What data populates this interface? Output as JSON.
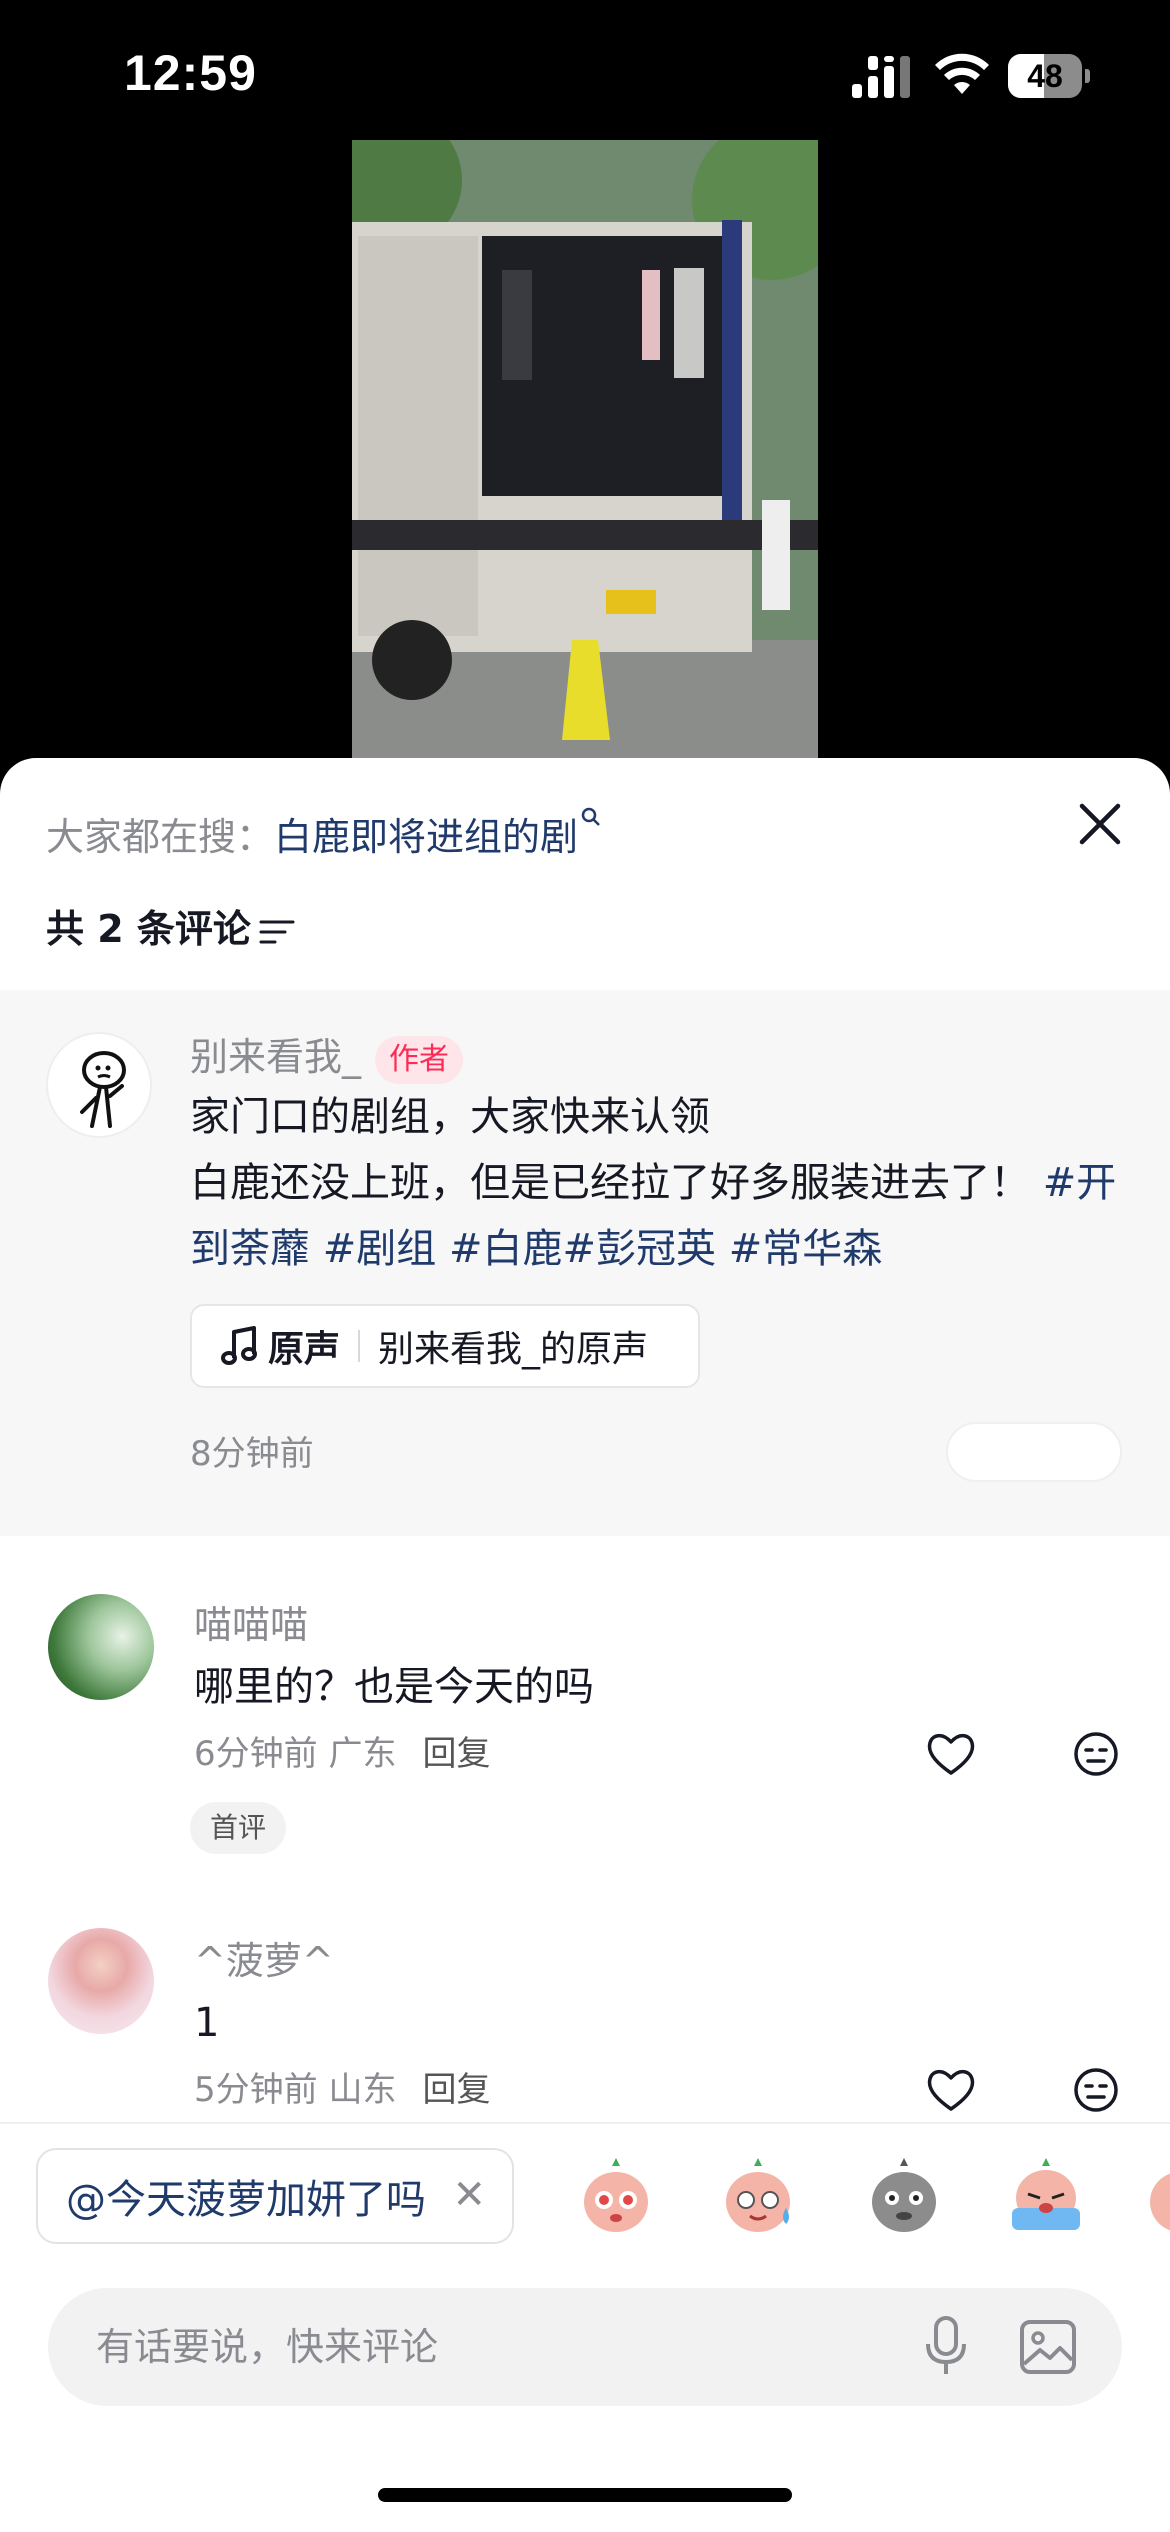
{
  "status_bar": {
    "time": "12:59",
    "battery": "48",
    "battery_level": 0.48
  },
  "sheet": {
    "search_prefix": "大家都在搜：",
    "search_keyword": "白鹿即将进组的剧",
    "comment_count_label": "共 2 条评论"
  },
  "author_comment": {
    "username": "别来看我_",
    "author_tag": "作者",
    "line1": "家门口的剧组，大家快来认领",
    "line2_text": "白鹿还没上班，但是已经拉了好多服装进去了！",
    "hashtag_1": "#开到荼蘼",
    "hashtag_2": "#剧组",
    "hashtag_3": "#白鹿",
    "hashtag_4": "#彭冠英",
    "hashtag_5": "#常华森",
    "sound_label": "原声",
    "sound_title": "别来看我_的原声",
    "time": "8分钟前"
  },
  "comments": [
    {
      "username": "喵喵喵",
      "text": "哪里的？也是今天的吗",
      "time": "6分钟前",
      "location": "广东",
      "reply": "回复",
      "badge": "首评"
    },
    {
      "username": "^菠萝^",
      "text": "1",
      "time": "5分钟前",
      "location": "山东",
      "reply": "回复"
    }
  ],
  "composer": {
    "mention": "@今天菠萝加妍了吗",
    "placeholder": "有话要说，快来评论"
  },
  "icons": [
    "signal-icon",
    "wifi-icon",
    "battery-icon",
    "search-icon",
    "close-icon",
    "sort-icon",
    "music-note-icon",
    "like-icon",
    "dislike-emoji-icon",
    "microphone-icon",
    "image-icon"
  ],
  "colors": {
    "accent": "#fe2c55",
    "link": "#1f3a6b",
    "muted": "#8a8b91"
  }
}
